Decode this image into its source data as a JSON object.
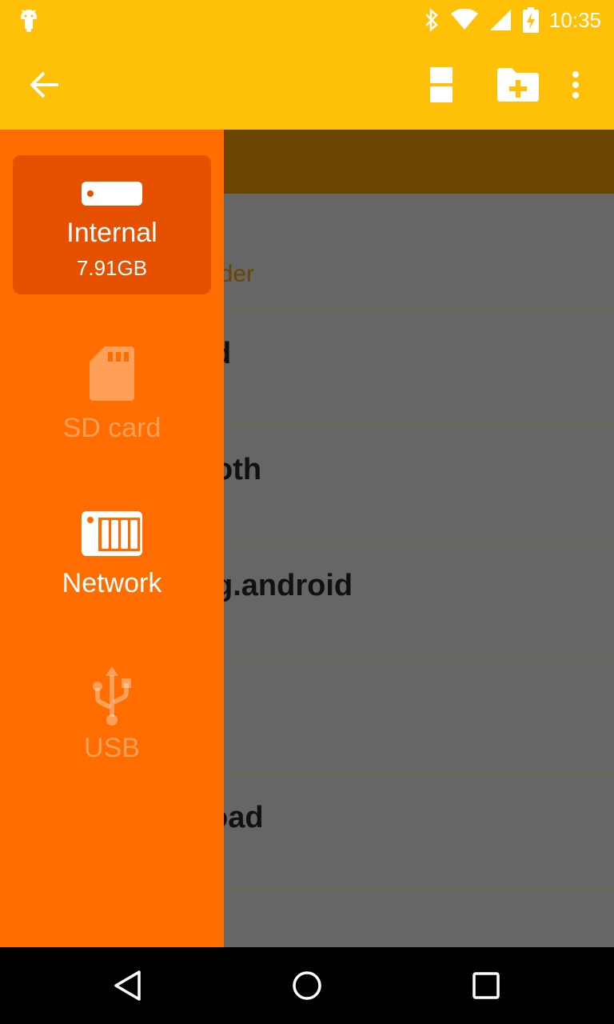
{
  "status_bar": {
    "time": "10:35",
    "icons": [
      "android-debug-icon",
      "bluetooth-icon",
      "wifi-icon",
      "signal-icon",
      "battery-charging-icon"
    ]
  },
  "app_bar": {
    "back_icon": "arrow-back-icon",
    "actions": [
      "view-toggle-icon",
      "create-folder-icon",
      "more-vert-icon"
    ]
  },
  "file_list": {
    "rows": [
      {
        "name": "",
        "sub": "lder"
      },
      {
        "name": "d",
        "sub": ""
      },
      {
        "name": "oth",
        "sub": ""
      },
      {
        "name": "g.android",
        "sub": ""
      },
      {
        "name": "",
        "sub": ""
      },
      {
        "name": "oad",
        "sub": ""
      }
    ]
  },
  "drawer": {
    "items": [
      {
        "label": "Internal",
        "size": "7.91GB",
        "icon": "internal-storage-icon",
        "selected": true,
        "enabled": true
      },
      {
        "label": "SD card",
        "size": "",
        "icon": "sd-card-icon",
        "selected": false,
        "enabled": false
      },
      {
        "label": "Network",
        "size": "",
        "icon": "network-storage-icon",
        "selected": false,
        "enabled": true
      },
      {
        "label": "USB",
        "size": "",
        "icon": "usb-icon",
        "selected": false,
        "enabled": false
      }
    ]
  },
  "nav_bar": {
    "buttons": [
      "back-triangle-icon",
      "home-circle-icon",
      "recents-square-icon"
    ]
  },
  "colors": {
    "app_bar": "#FFC107",
    "drawer": "#FF6D00",
    "drawer_selected": "#E65100",
    "content_dim": "#666666",
    "path_bar": "#6B4500"
  }
}
